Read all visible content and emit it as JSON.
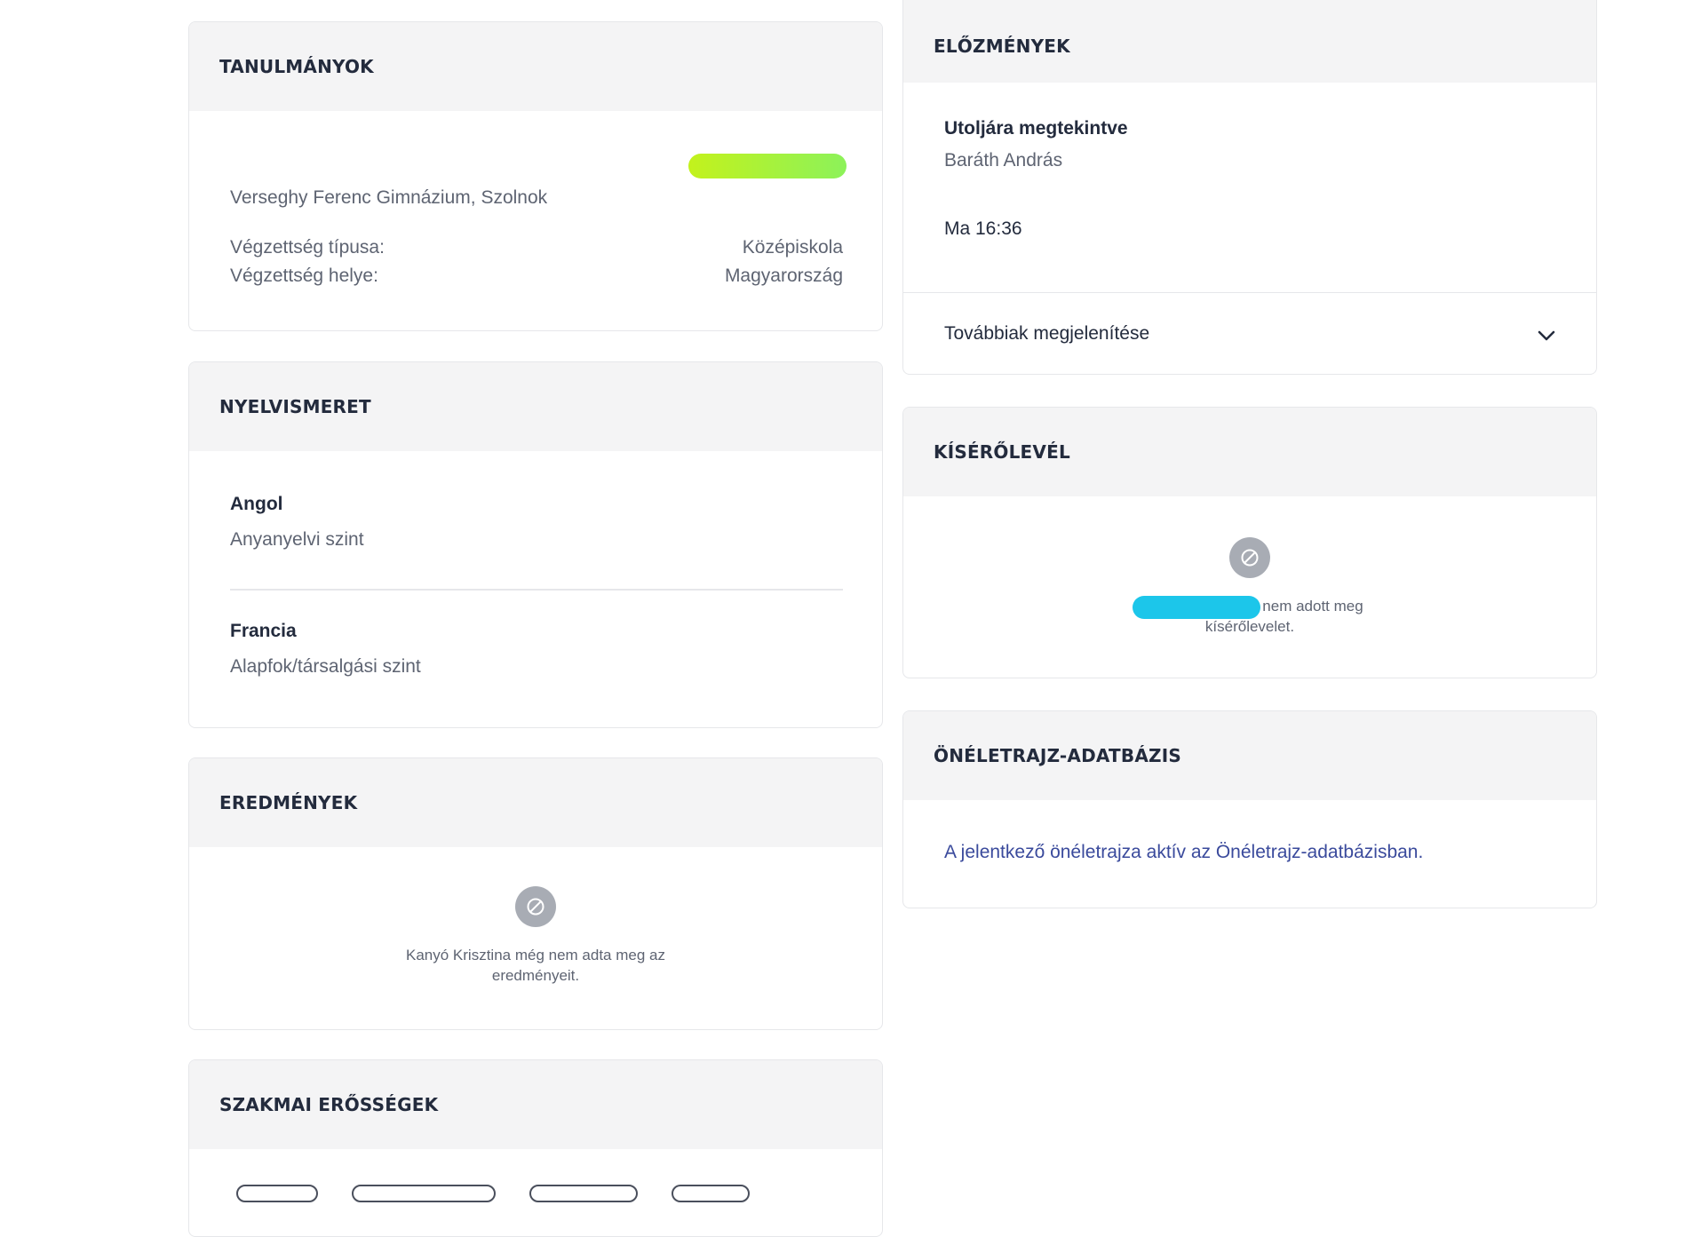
{
  "studies": {
    "title": "TANULMÁNYOK",
    "school": "Verseghy Ferenc Gimnázium, Szolnok",
    "rows": [
      {
        "label": "Végzettség típusa:",
        "value": "Középiskola"
      },
      {
        "label": "Végzettség helye:",
        "value": "Magyarország"
      }
    ]
  },
  "languages": {
    "title": "NYELVISMERET",
    "items": [
      {
        "name": "Angol",
        "level": "Anyanyelvi szint"
      },
      {
        "name": "Francia",
        "level": "Alapfok/társalgási szint"
      }
    ]
  },
  "results": {
    "title": "EREDMÉNYEK",
    "empty_line1": "Kanyó Krisztina még nem adta meg az",
    "empty_line2": "eredményeit."
  },
  "strengths": {
    "title": "SZAKMAI ERŐSSÉGEK"
  },
  "history": {
    "title": "ELŐZMÉNYEK",
    "last_viewed_label": "Utoljára megtekintve",
    "viewer": "Baráth András",
    "time": "Ma 16:36",
    "show_more": "Továbbiak megjelenítése"
  },
  "cover_letter": {
    "title": "KÍSÉRŐLEVÉL",
    "empty_line1": "nem adott meg",
    "empty_line2": "kísérőlevelet."
  },
  "cv_db": {
    "title": "ÖNÉLETRAJZ-ADATBÁZIS",
    "link": "A jelentkező önéletrajza aktív az Önéletrajz-adatbázisban."
  },
  "colors": {
    "link": "#3a4a9c",
    "redact_green": "#9af23c",
    "redact_cyan": "#1cc6ea",
    "header_bg": "#f4f4f5"
  },
  "icons": {
    "empty": "ban-icon",
    "expand": "chevron-down-icon"
  }
}
